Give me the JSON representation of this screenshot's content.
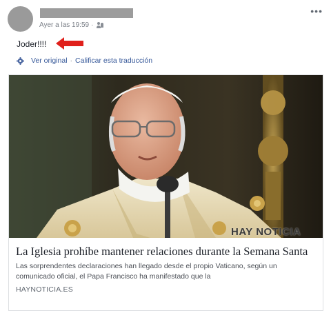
{
  "post": {
    "timestamp": "Ayer a las 19:59",
    "meta_separator": "·",
    "text": "Joder!!!!",
    "more_glyph": "•••",
    "translation": {
      "see_original": "Ver original",
      "separator": "·",
      "rate_translation": "Calificar esta traducción"
    },
    "icons": {
      "audience": "friends-icon",
      "settings": "gear-icon",
      "more": "more-options-icon",
      "annotation": "red-arrow-icon"
    },
    "colors": {
      "link": "#365899",
      "annotation_arrow": "#e0201b",
      "redaction": "#9c9c9c"
    }
  },
  "shared_link": {
    "watermark": "HAY NOTICIA",
    "title": "La Iglesia prohíbe mantener relaciones durante la Semana Santa",
    "description": "Las sorprendentes declaraciones han llegado desde el propio Vaticano, según un comunicado oficial, el Papa Francisco ha manifestado que la",
    "domain": "HAYNOTICIA.ES"
  }
}
